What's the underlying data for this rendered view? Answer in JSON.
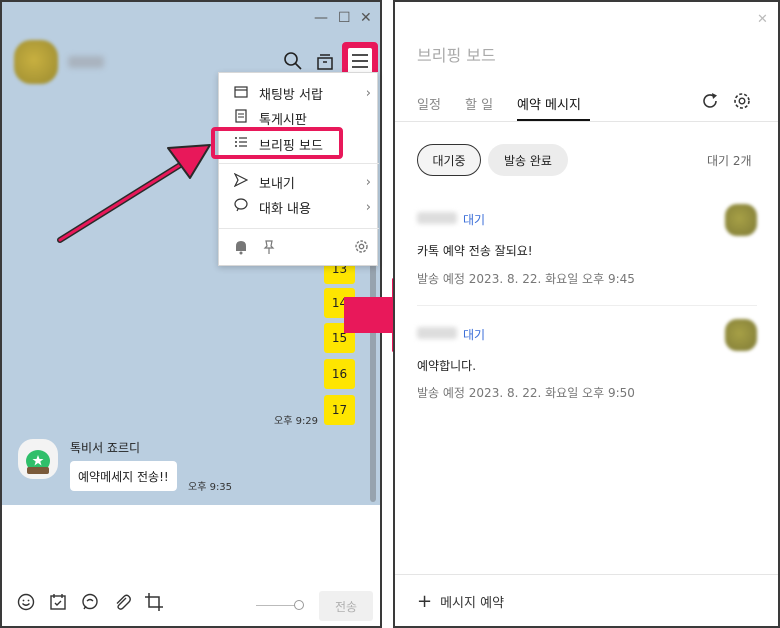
{
  "left_window": {
    "controls": {
      "minimize": "—",
      "maximize": "☐",
      "close": "✕"
    },
    "header_icons": [
      "search-icon",
      "archive-icon",
      "menu-icon"
    ],
    "dropdown": {
      "items": [
        {
          "label": "채팅방 서랍",
          "icon": "drawer-icon",
          "has_submenu": true
        },
        {
          "label": "톡게시판",
          "icon": "board-icon",
          "has_submenu": false
        },
        {
          "label": "브리핑 보드",
          "icon": "list-icon",
          "has_submenu": false
        },
        {
          "label": "보내기",
          "icon": "send-icon",
          "has_submenu": true
        },
        {
          "label": "대화 내용",
          "icon": "chat-icon",
          "has_submenu": true
        }
      ],
      "footer_icons": [
        "bell-icon",
        "pin-icon",
        "gear-icon"
      ]
    },
    "messages": {
      "numbers": [
        "13",
        "14",
        "15",
        "16",
        "17"
      ],
      "time_1": "오후 9:29",
      "bot_name": "톡비서 죠르디",
      "bot_message": "예약메세지 전송!!",
      "time_2": "오후 9:35"
    },
    "toolbar_icons": [
      "emoji-icon",
      "calendar-icon",
      "bubble-icon",
      "attach-icon",
      "crop-icon"
    ],
    "send_label": "전송"
  },
  "right_window": {
    "close": "✕",
    "title": "브리핑 보드",
    "tabs": [
      {
        "label": "일정",
        "active": false
      },
      {
        "label": "할 일",
        "active": false
      },
      {
        "label": "예약 메시지",
        "active": true
      }
    ],
    "filters": {
      "waiting": "대기중",
      "sent": "발송 완료"
    },
    "waiting_count": "대기 2개",
    "messages": [
      {
        "status": "대기",
        "text": "카톡 예약 전송 잘되요!",
        "meta": "발송 예정  2023. 8. 22. 화요일 오후 9:45"
      },
      {
        "status": "대기",
        "text": "예약합니다.",
        "meta": "발송 예정  2023. 8. 22. 화요일 오후 9:50"
      }
    ],
    "add_label": "메시지 예약"
  },
  "colors": {
    "highlight": "#e8185a",
    "chat_bg": "#bacee0",
    "bubble_yellow": "#fee500",
    "status_blue": "#3a6ed8"
  }
}
